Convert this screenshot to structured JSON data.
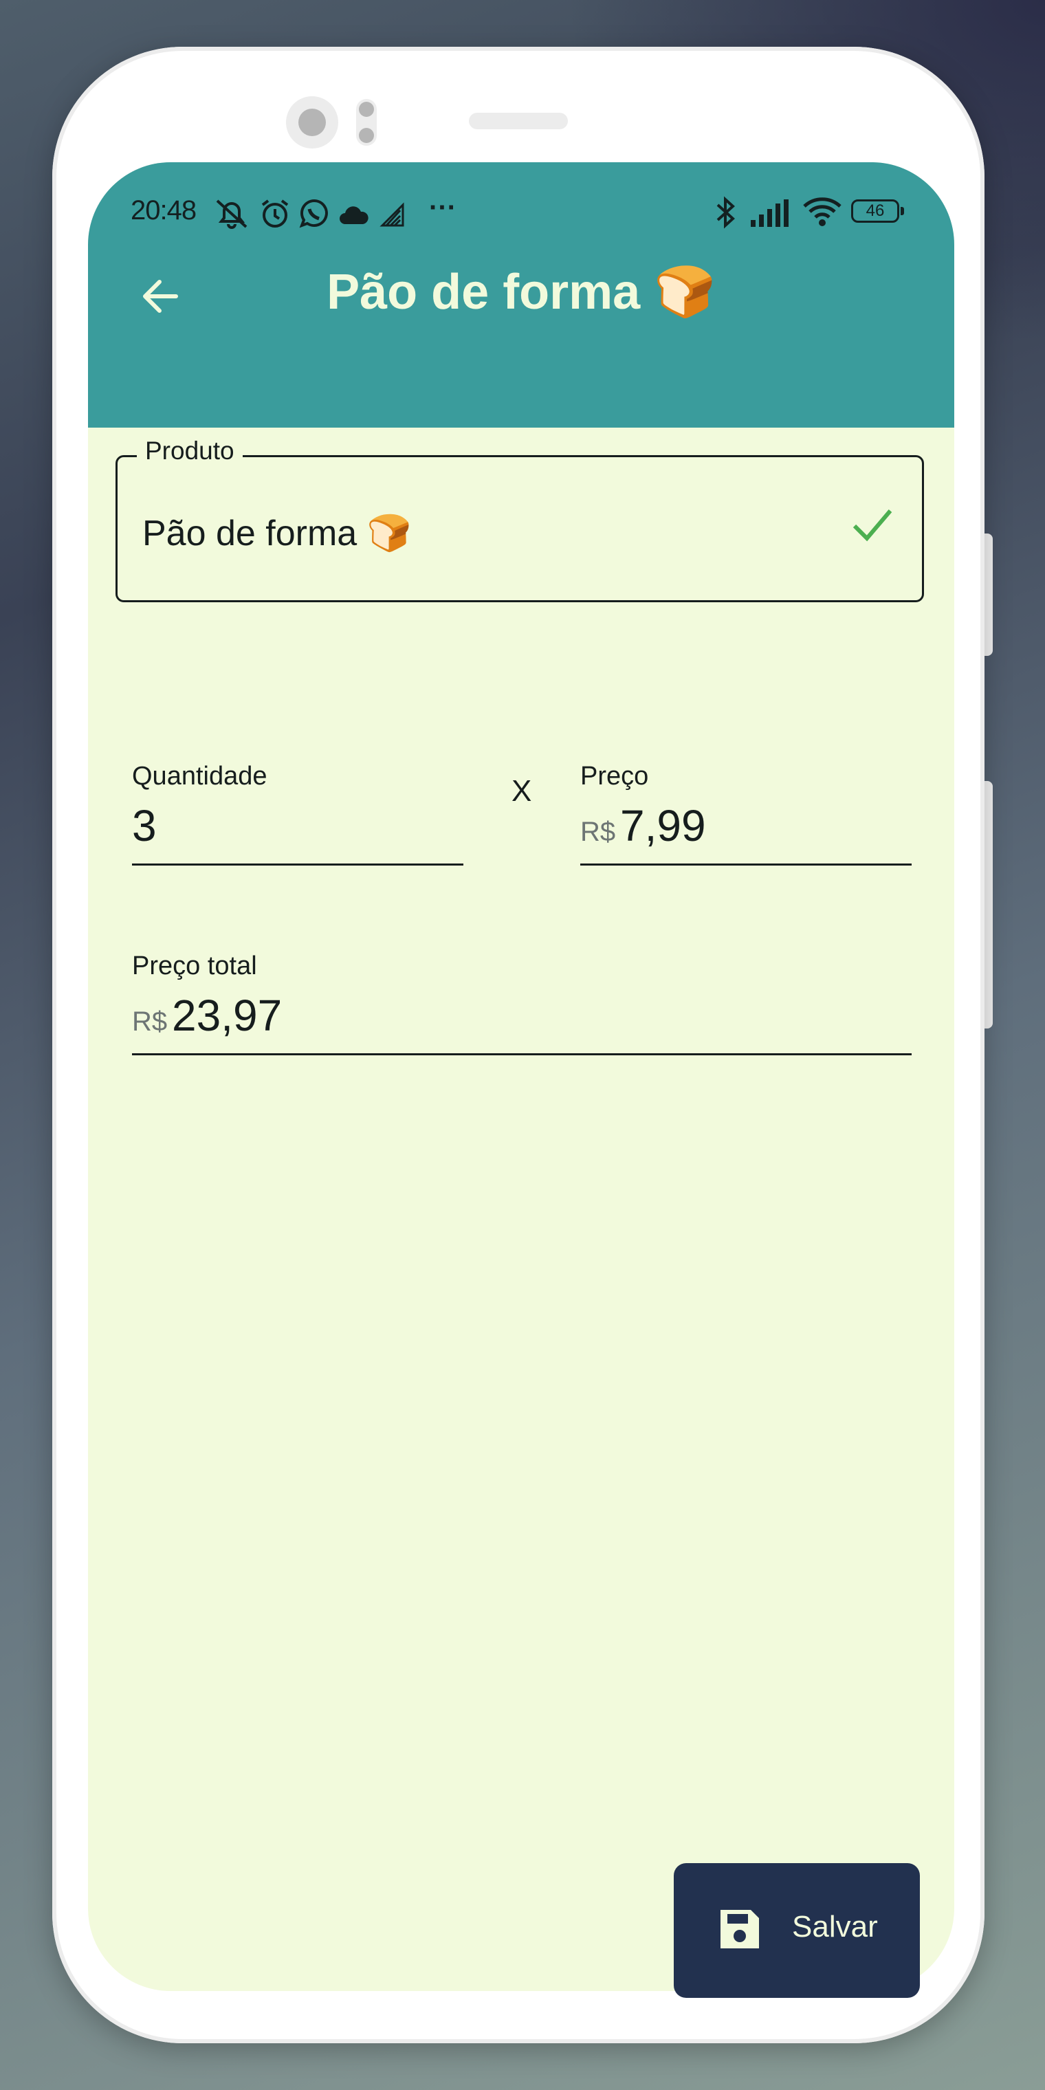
{
  "status_bar": {
    "time": "20:48",
    "more_indicator": "···",
    "battery": "46",
    "icons": [
      "bell-off-icon",
      "alarm-icon",
      "whatsapp-icon",
      "cloud-icon",
      "signal-alt-icon",
      "bluetooth-icon",
      "cellular-signal-icon",
      "wifi-icon",
      "battery-icon"
    ]
  },
  "app_bar": {
    "title": "Pão de forma 🍞",
    "back_icon": "arrow-left-icon",
    "background": "#3a9c9c",
    "title_color": "#f2fadc"
  },
  "form": {
    "product": {
      "label": "Produto",
      "value": "Pão de forma 🍞",
      "valid_icon": "check-icon",
      "valid_color": "#4caf50"
    },
    "quantity": {
      "label": "Quantidade",
      "value": "3"
    },
    "multiply_sign": "X",
    "price": {
      "label": "Preço",
      "prefix": "R$",
      "value": "7,99"
    },
    "total": {
      "label": "Preço total",
      "prefix": "R$",
      "value": "23,97"
    }
  },
  "fab": {
    "label": "Salvar",
    "icon": "save-icon",
    "background": "#22314f"
  },
  "colors": {
    "screen_background": "#f2fadc",
    "text": "#161d1d"
  }
}
